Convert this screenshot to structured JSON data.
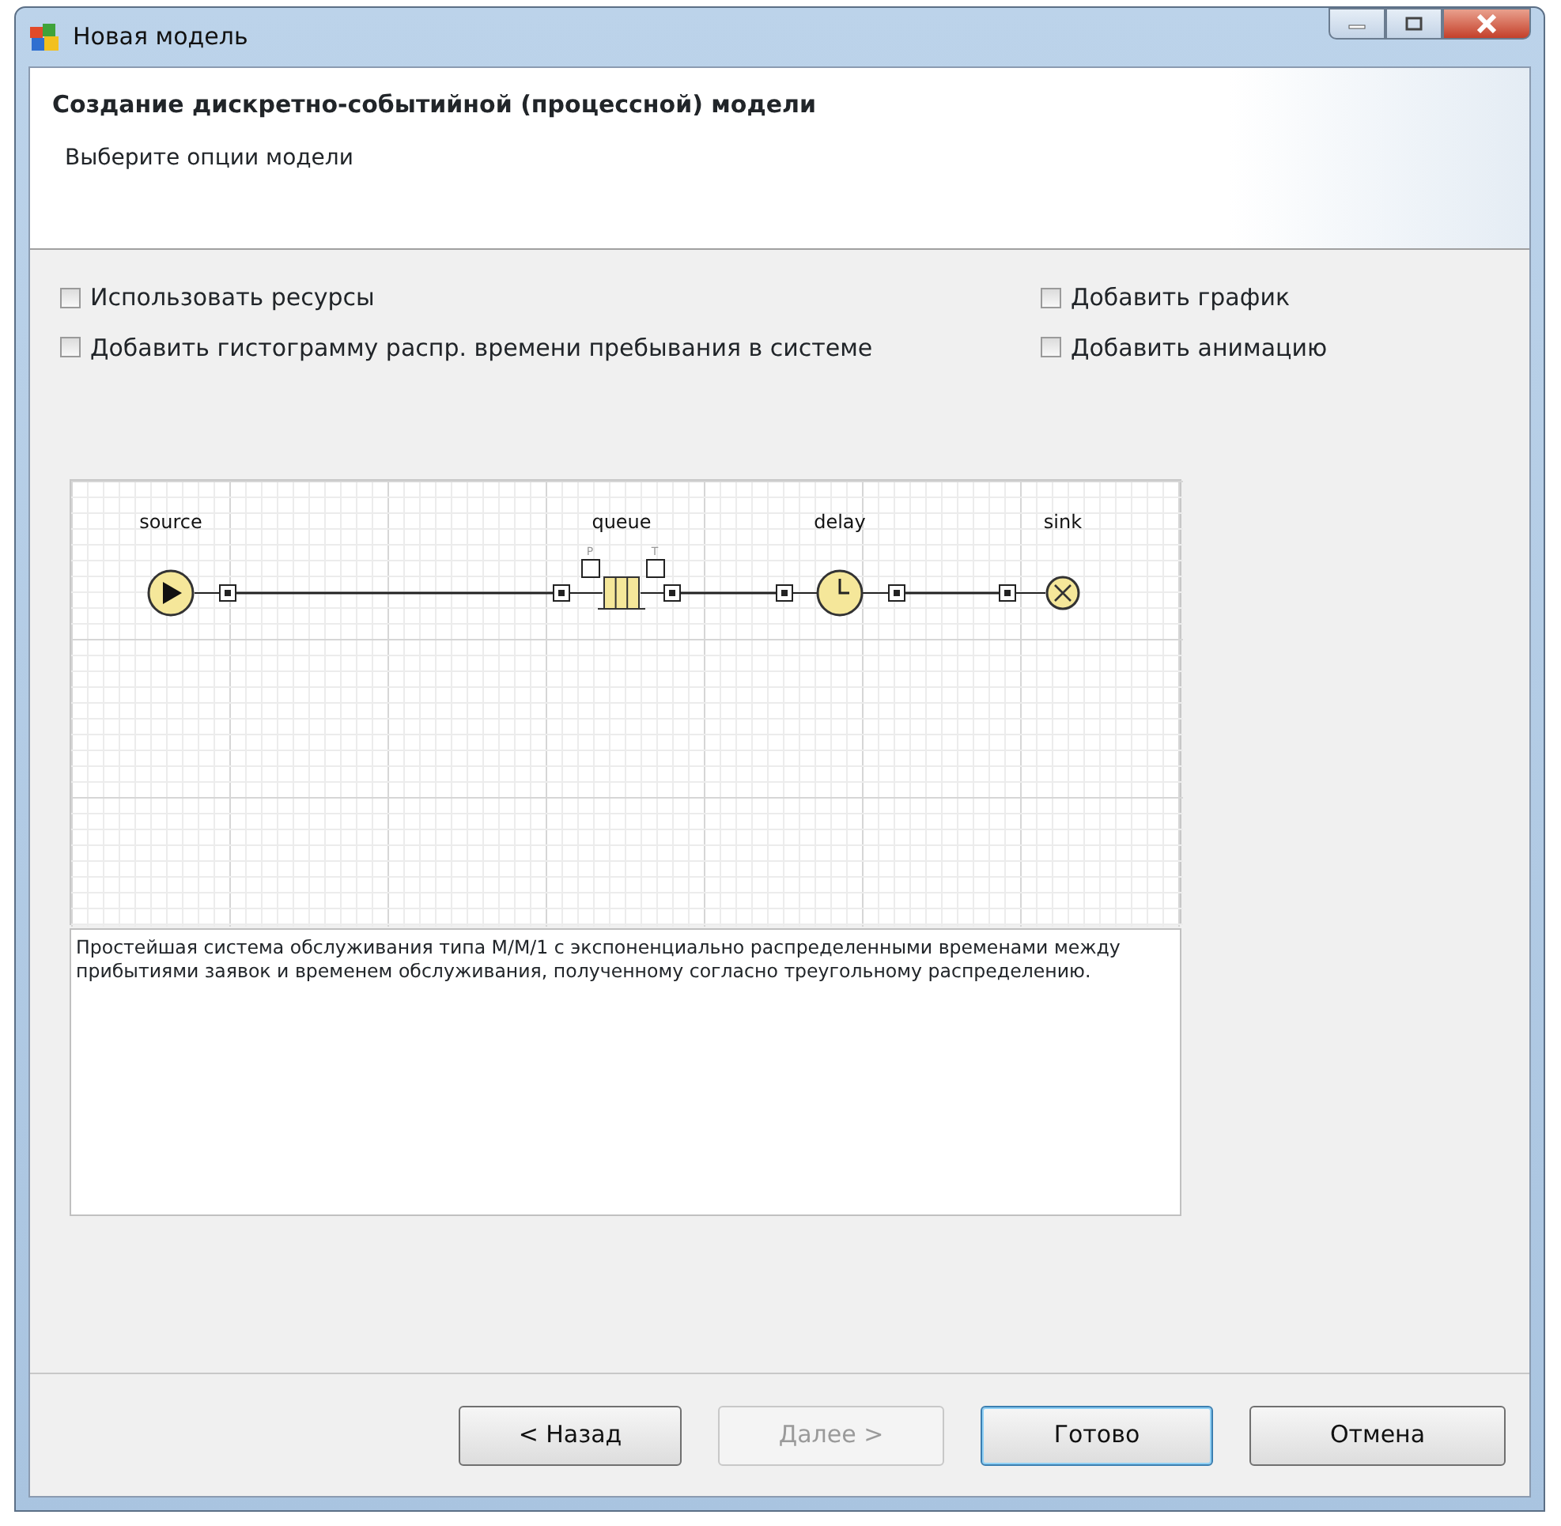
{
  "window": {
    "title": "Новая модель"
  },
  "header": {
    "title": "Создание дискретно-событийной (процессной) модели",
    "subtitle": "Выберите опции модели"
  },
  "options": [
    {
      "label": "Использовать ресурсы",
      "checked": false
    },
    {
      "label": "Добавить график",
      "checked": false
    },
    {
      "label": "Добавить гистограмму распр. времени пребывания в системе",
      "checked": false
    },
    {
      "label": "Добавить анимацию",
      "checked": false
    }
  ],
  "diagram": {
    "nodes": [
      {
        "kind": "source",
        "label": "source"
      },
      {
        "kind": "queue",
        "label": "queue",
        "port_labels": [
          "P",
          "T"
        ]
      },
      {
        "kind": "delay",
        "label": "delay"
      },
      {
        "kind": "sink",
        "label": "sink"
      }
    ]
  },
  "description": "Простейшая система обслуживания типа M/M/1 с экспоненциально распределенными временами между прибытиями заявок и временем обслуживания, полученному согласно треугольному распределению.",
  "buttons": [
    {
      "label": "< Назад",
      "disabled": false,
      "default": false
    },
    {
      "label": "Далее >",
      "disabled": true,
      "default": false
    },
    {
      "label": "Готово",
      "disabled": false,
      "default": true
    },
    {
      "label": "Отмена",
      "disabled": false,
      "default": false
    }
  ]
}
